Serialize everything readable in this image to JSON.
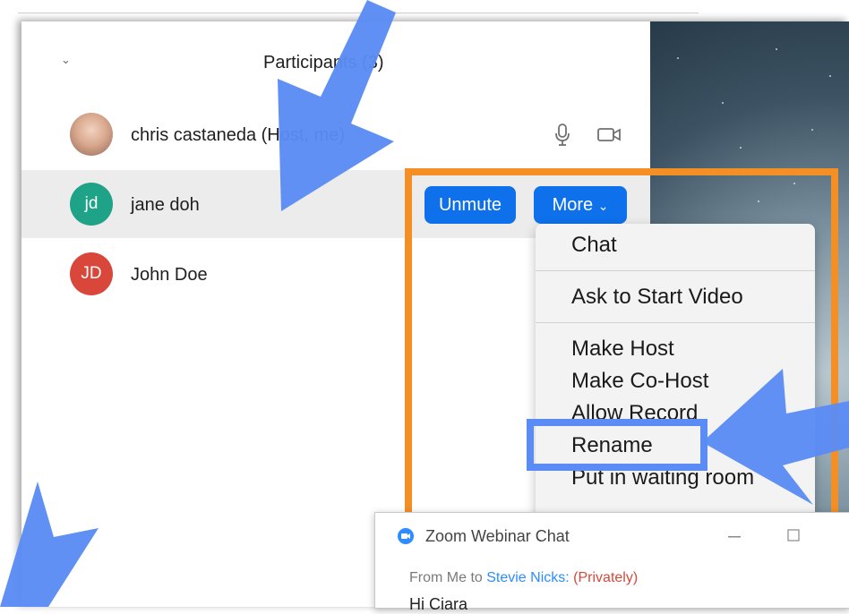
{
  "participants": {
    "title": "Participants (3)",
    "rows": [
      {
        "name": "chris castaneda (Host, me)",
        "initials": "",
        "color": "#b98b75"
      },
      {
        "name": "jane doh",
        "initials": "jd",
        "color": "#1fa388"
      },
      {
        "name": "John Doe",
        "initials": "JD",
        "color": "#d9473b"
      }
    ],
    "actions": {
      "unmute": "Unmute",
      "more": "More"
    }
  },
  "menu": {
    "items": [
      "Chat",
      "Ask to Start Video",
      "Make Host",
      "Make Co-Host",
      "Allow Record",
      "Rename",
      "Put in waiting room"
    ]
  },
  "chat_window": {
    "title": "Zoom Webinar Chat",
    "from_prefix": "From Me to ",
    "recipient": "Stevie Nicks:",
    "privacy": "(Privately)",
    "message": "Hi Ciara"
  },
  "colors": {
    "accent_blue": "#0e71eb",
    "annotation_arrow": "#5b8bf5",
    "highlight_box": "#f48f25"
  }
}
